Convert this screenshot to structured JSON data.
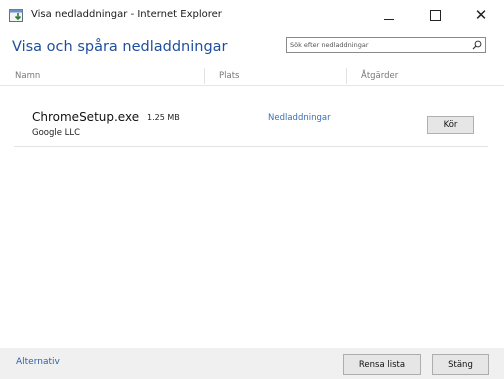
{
  "window": {
    "title": "Visa nedladdningar - Internet Explorer",
    "minimize_icon": "minimize-icon",
    "maximize_icon": "maximize-icon",
    "close_glyph": "✕"
  },
  "header": {
    "heading": "Visa och spåra nedladdningar",
    "search_placeholder": "Sök efter nedladdningar",
    "search_value": ""
  },
  "columns": [
    "Namn",
    "Plats",
    "Åtgärder"
  ],
  "downloads": [
    {
      "file_name": "ChromeSetup.exe",
      "size": "1.25 MB",
      "publisher": "Google LLC",
      "location": "Nedladdningar",
      "action": "Kör"
    }
  ],
  "footer": {
    "options_link": "Alternativ",
    "clear_list": "Rensa lista",
    "close": "Stäng"
  },
  "colors": {
    "accent": "#1f4e9e",
    "link": "#3a6fb5",
    "footer_bg": "#f0f0f0"
  }
}
